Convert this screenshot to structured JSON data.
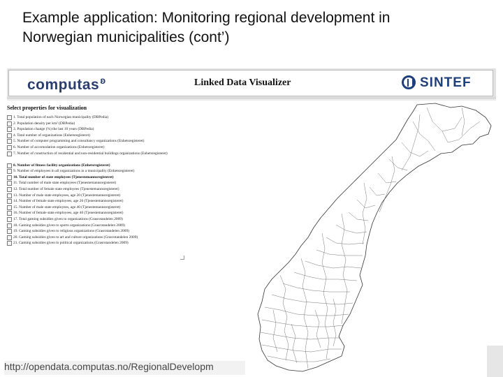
{
  "slide": {
    "title_line1": "Example application: Monitoring regional development in",
    "title_line2": "Norwegian municipalities (cont’)"
  },
  "header": {
    "logo_left": "computas",
    "app_title": "Linked Data Visualizer",
    "logo_right": "SINTEF"
  },
  "panel": {
    "heading": "Select properties for visualization",
    "properties": [
      {
        "label": "1. Total population of each Norwegian municipality (DBPedia)"
      },
      {
        "label": "2. Population density per km² (DBPedia)"
      },
      {
        "label": "3. Population change (%) the last 10 years (DBPedia)"
      },
      {
        "label": "4. Total number of organizations (Enhetsregisteret)"
      },
      {
        "label": "5. Number of computer programming and consultancy organizations (Enhetsregisteret)"
      },
      {
        "label": "6. Number of accomodation organizations (Enhetsregisteret)"
      },
      {
        "label": "7. Number of construction of residential and non-residential buildings organizations (Enhetsregisteret)"
      },
      {
        "label": "8. Number of fitness facility organizations (Enhetsregisteret)"
      },
      {
        "label": "9. Number of employees in all organizations in a municipality (Enhetsregisteret)"
      },
      {
        "label": "10. Total number of state employees (Tjenestemannsregisteret)"
      },
      {
        "label": "11. Total number of male state employees (Tjenestemannsregisteret)"
      },
      {
        "label": "12. Total number of female state employees (Tjenestemannsregisteret)"
      },
      {
        "label": "13. Number of male state employees, age 20 (Tjenestemannsregisteret)"
      },
      {
        "label": "14. Number of female state employees, age 20 (Tjenestemannsregisteret)"
      },
      {
        "label": "15. Number of male state employees, age 40 (Tjenestemannsregisteret)"
      },
      {
        "label": "16. Number of female state employees, age 40 (Tjenestemannsregisteret)"
      },
      {
        "label": "17. Total gaming subsidies given to organizations (Grasrotandelen 2009)"
      },
      {
        "label": "18. Gaming subsidies given to sports organizations (Grasrotandelen 2009)"
      },
      {
        "label": "19. Gaming subsidies given to religious organizations (Grasrotandelen 2009)"
      },
      {
        "label": "20. Gaming subsidies given to art and culture organizations (Grasrotandelen 2009)"
      },
      {
        "label": "21. Gaming subsidies given to political organizations (Grasrotandelen 2009)"
      }
    ]
  },
  "footer": {
    "url": "http://opendata.computas.no/RegionalDevelopm"
  }
}
